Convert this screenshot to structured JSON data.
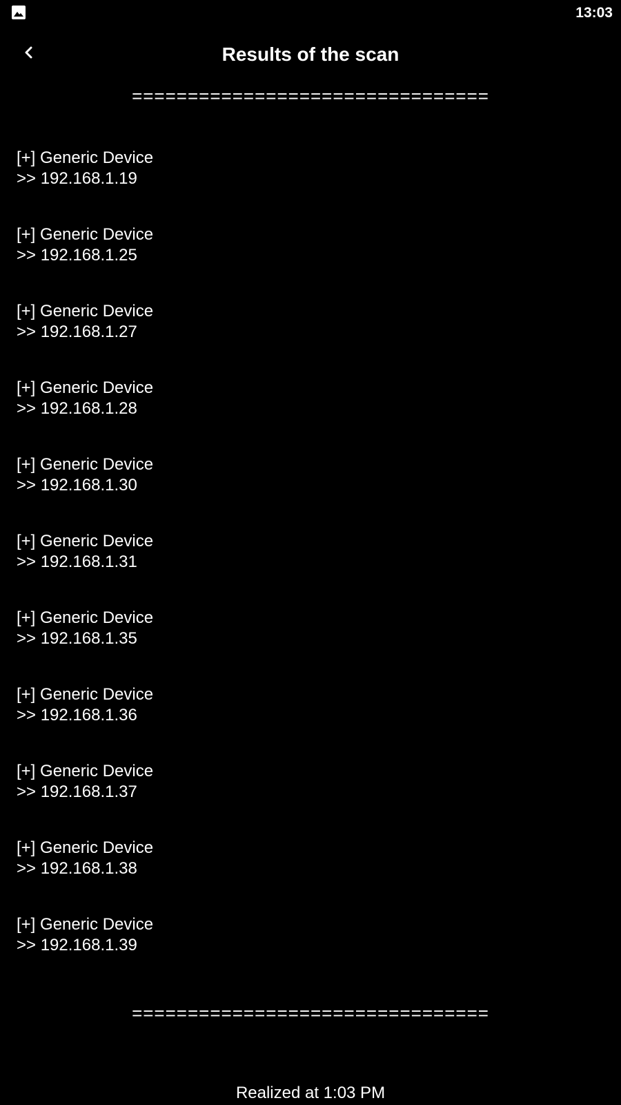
{
  "status_bar": {
    "time": "13:03",
    "notification_icon": "gallery-image-icon"
  },
  "header": {
    "title": "Results of the scan",
    "back_icon": "chevron-left-icon"
  },
  "separator": {
    "top": "================================",
    "bottom": "================================"
  },
  "results": [
    {
      "name": "[+] Generic Device",
      "ip": ">> 192.168.1.19"
    },
    {
      "name": "[+] Generic Device",
      "ip": ">> 192.168.1.25"
    },
    {
      "name": "[+] Generic Device",
      "ip": ">> 192.168.1.27"
    },
    {
      "name": "[+] Generic Device",
      "ip": ">> 192.168.1.28"
    },
    {
      "name": "[+] Generic Device",
      "ip": ">> 192.168.1.30"
    },
    {
      "name": "[+] Generic Device",
      "ip": ">> 192.168.1.31"
    },
    {
      "name": "[+] Generic Device",
      "ip": ">> 192.168.1.35"
    },
    {
      "name": "[+] Generic Device",
      "ip": ">> 192.168.1.36"
    },
    {
      "name": "[+] Generic Device",
      "ip": ">> 192.168.1.37"
    },
    {
      "name": "[+] Generic Device",
      "ip": ">> 192.168.1.38"
    },
    {
      "name": "[+] Generic Device",
      "ip": ">> 192.168.1.39"
    }
  ],
  "footer": {
    "realized_text": "Realized at 1:03 PM"
  },
  "colors": {
    "background": "#000000",
    "text": "#ffffff"
  }
}
